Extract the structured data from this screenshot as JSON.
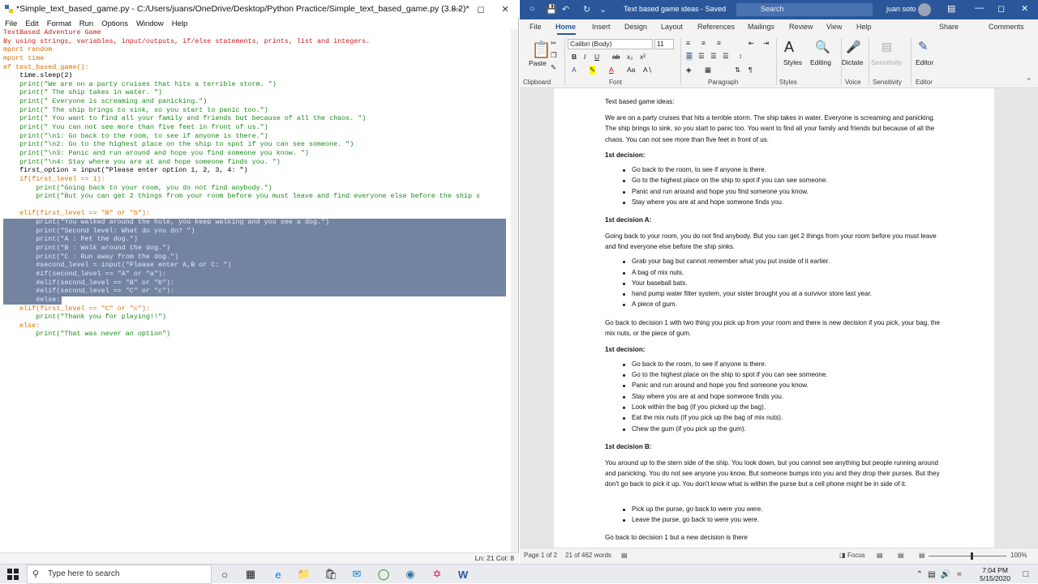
{
  "idle": {
    "title": "*Simple_text_based_game.py - C:/Users/juans/OneDrive/Desktop/Python Practice/Simple_text_based_game.py (3.8.2)*",
    "menu": [
      "File",
      "Edit",
      "Format",
      "Run",
      "Options",
      "Window",
      "Help"
    ],
    "status": "Ln: 21   Col: 8",
    "code_lines": [
      {
        "t": "TextBased Adventure Game",
        "c": "red"
      },
      {
        "t": "By using strings, variables, input/outputs, if/else statements, prints, list and integers.",
        "c": "red"
      },
      {
        "t": "mport random",
        "c": "org"
      },
      {
        "t": "mport time",
        "c": "org"
      },
      {
        "t": "ef text_based_game():",
        "c": "org"
      },
      {
        "t": "    time.sleep(2)",
        "c": "blk"
      },
      {
        "t": "    print(\"We are on a party cruises that hits a terrible storm. \")",
        "c": "grn"
      },
      {
        "t": "    print(\" The ship takes in water. \")",
        "c": "grn"
      },
      {
        "t": "    print(\" Everyone is screaming and panicking.\")",
        "c": "grn"
      },
      {
        "t": "    print(\" The ship brings to sink, so you start to panic too.\")",
        "c": "grn"
      },
      {
        "t": "    print(\" You want to find all your family and friends but because of all the chaos. \")",
        "c": "grn"
      },
      {
        "t": "    print(\" You can not see more than five feet in front of us.\")",
        "c": "grn"
      },
      {
        "t": "    print(\"\\n1: Go back to the room, to see if anyone is there.\")",
        "c": "grn"
      },
      {
        "t": "    print(\"\\n2: Go to the highest place on the ship to spot if you can see someone. \")",
        "c": "grn"
      },
      {
        "t": "    print(\"\\n3: Panic and run around and hope you find someone you know. \")",
        "c": "grn"
      },
      {
        "t": "    print(\"\\n4: Stay where you are at and hope someone finds you. \")",
        "c": "grn"
      },
      {
        "t": "    first_option = input(\"Please enter option 1, 2, 3, 4: \")",
        "c": "blk"
      },
      {
        "t": "    if(first_level == 1):",
        "c": "org"
      },
      {
        "t": "        print(\"Going back to your room, you do not find anybody.\")",
        "c": "grn"
      },
      {
        "t": "        print(\"But you can get 2 things from your room before you must leave and find everyone else before the ship s",
        "c": "grn"
      },
      {
        "t": "",
        "c": "blk"
      },
      {
        "t": "    elif(first_level == \"B\" or \"b\"):",
        "c": "org"
      },
      {
        "t": "        print(\"You walked around the hole, you keep walking and you see a dog.\")",
        "c": "sel"
      },
      {
        "t": "        print(\"Second level: What do you do? \")",
        "c": "sel"
      },
      {
        "t": "        print(\"A : Pet the dog.\")",
        "c": "sel"
      },
      {
        "t": "        print(\"B : Walk around the dog.\")",
        "c": "sel"
      },
      {
        "t": "        print(\"C : Run away from the dog.\")",
        "c": "sel"
      },
      {
        "t": "        #second_level = input(\"Please enter A,B or C: \")",
        "c": "sel"
      },
      {
        "t": "        #if(second_level == \"A\" or \"a\"):",
        "c": "sel"
      },
      {
        "t": "        #elif(second_level == \"B\" or \"b\"):",
        "c": "sel"
      },
      {
        "t": "        #elif(second_level == \"C\" or \"c\"):",
        "c": "sel"
      },
      {
        "t": "        #else:",
        "c": "sel"
      },
      {
        "t": "    elif(first_level == \"C\" or \"c\"):",
        "c": "org"
      },
      {
        "t": "        print(\"Thank you for playing!!\")",
        "c": "grn"
      },
      {
        "t": "    else:",
        "c": "org"
      },
      {
        "t": "        print(\"That was never an option\")",
        "c": "grn"
      }
    ]
  },
  "word": {
    "title": "Text based game ideas  -  Saved",
    "search_placeholder": "Search",
    "user": "juan soto",
    "tabs": [
      "File",
      "Home",
      "Insert",
      "Design",
      "Layout",
      "References",
      "Mailings",
      "Review",
      "View",
      "Help"
    ],
    "share": "Share",
    "comments": "Comments",
    "font_name": "Calibri (Body)",
    "font_size": "11",
    "ribbon_groups": [
      "Clipboard",
      "Font",
      "Paragraph",
      "Styles",
      "Voice",
      "Sensitivity",
      "Editor"
    ],
    "ribbon_buttons": {
      "paste": "Paste",
      "styles": "Styles",
      "editing": "Editing",
      "dictate": "Dictate",
      "sensitivity": "Sensitivity",
      "editor": "Editor"
    },
    "doc": {
      "heading": "Text based game ideas:",
      "intro": "We are on a party cruises that hits a terrible storm. The ship takes in water. Everyone is screaming and panicking. The ship brings to sink, so you start to panic too. You want to find all your family and friends but because of all the chaos. You can not see more than five feet in front of us.",
      "d1": "1st decision:",
      "d1_items": [
        "Go back to the room, to see if anyone is there.",
        "Go to the highest place on the ship to spot if you can see someone.",
        "Panic and run around and hope you find someone you know.",
        "Stay where you are at and hope someone finds you."
      ],
      "d1a": "1st decision A:",
      "d1a_text": "Going back to your room, you do not find anybody. But you can get 2 things from your room before you must leave and find everyone else before the ship sinks.",
      "d1a_items": [
        "Grab your bag but cannot remember what you put inside of it earlier.",
        "A bag of mix nuts.",
        "Your baseball bats.",
        "hand pump water filter system, your sister brought you at a survivor store last year.",
        "A piece of gum."
      ],
      "goback": "Go back to decision 1 with two thing you pick up from your room and there is new decision if you pick, your bag, the mix nuts, or the piece of gum.",
      "d1b_head": "1st decision:",
      "d1b_items": [
        "Go back to the room, to see if anyone is there.",
        "Go to the highest place on the ship to spot if you can see someone.",
        "Panic and run around and hope you find someone you know.",
        "Stay where you are at and hope someone finds you.",
        "Look within the bag (if you picked up the bag).",
        "Eat the mix nuts (If you pick up the bag of mix nuts).",
        "Chew the gum (if you pick up the gum)."
      ],
      "d1B": "1st decision B:",
      "d1B_text": "You around up to the stern side of the ship. You look down, but you cannot see anything but people running around and panicking. You do not see anyone you know. But someone bumps into you and they drop their purses. But they don't go back to pick it up. You don't know what is within the purse but a cell phone might be in side of it.",
      "d1B_items": [
        "Pick up the purse, go back to were you were.",
        "Leave the purse, go back to were you were."
      ],
      "tail": "Go back to decision 1 but a new decision is there"
    },
    "status_left": "Page 1 of 2",
    "status_words": "21 of 462 words",
    "focus": "Focus",
    "zoom": "100%"
  },
  "taskbar": {
    "search_placeholder": "Type here to search",
    "time": "7:04 PM",
    "date": "5/15/2020"
  }
}
